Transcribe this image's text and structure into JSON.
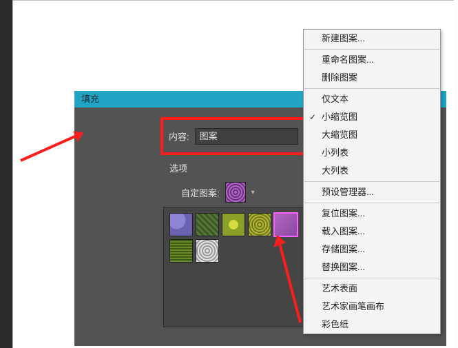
{
  "dialog": {
    "title": "填充",
    "content_label": "内容:",
    "content_value": "图案",
    "options_label": "选项",
    "custom_label": "自定图案:"
  },
  "gear": {
    "icon": "gear-icon"
  },
  "menu": {
    "items": [
      {
        "label": "新建图案...",
        "sep_after": true
      },
      {
        "label": "重命名图案..."
      },
      {
        "label": "删除图案",
        "sep_after": true
      },
      {
        "label": "仅文本"
      },
      {
        "label": "小缩览图",
        "checked": true
      },
      {
        "label": "大缩览图"
      },
      {
        "label": "小列表"
      },
      {
        "label": "大列表",
        "sep_after": true
      },
      {
        "label": "预设管理器...",
        "sep_after": true
      },
      {
        "label": "复位图案..."
      },
      {
        "label": "载入图案..."
      },
      {
        "label": "存储图案..."
      },
      {
        "label": "替换图案...",
        "sep_after": true
      },
      {
        "label": "艺术表面"
      },
      {
        "label": "艺术家画笔画布"
      },
      {
        "label": "彩色纸"
      }
    ]
  }
}
